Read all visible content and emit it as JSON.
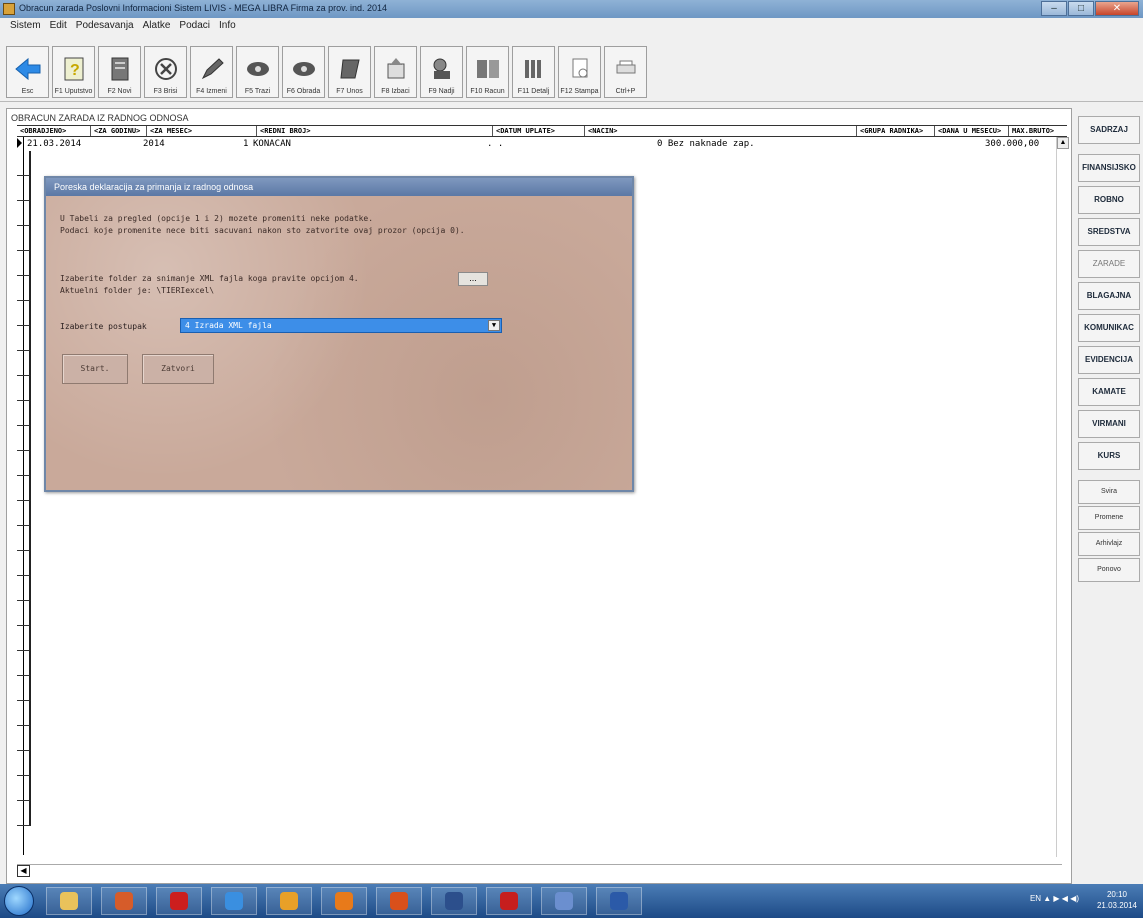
{
  "window": {
    "title": "Obracun zarada  Poslovni Informacioni Sistem LIVIS - MEGA LIBRA  Firma za prov. ind. 2014",
    "controls": [
      "–",
      "□",
      "✕"
    ]
  },
  "menu": [
    "Sistem",
    "Edit",
    "Podesavanja",
    "Alatke",
    "Podaci",
    "Info"
  ],
  "toolbar": [
    {
      "label": "Esc",
      "icon": "back-arrow-icon"
    },
    {
      "label": "F1 Uputstvo",
      "icon": "help-icon"
    },
    {
      "label": "F2 Novi",
      "icon": "new-document-icon"
    },
    {
      "label": "F3 Brisi",
      "icon": "delete-icon"
    },
    {
      "label": "F4 Izmeni",
      "icon": "edit-icon"
    },
    {
      "label": "F5 Trazi",
      "icon": "search-icon"
    },
    {
      "label": "F6 Obrada",
      "icon": "process-icon"
    },
    {
      "label": "F7 Unos",
      "icon": "input-icon"
    },
    {
      "label": "F8 Izbaci",
      "icon": "export-icon"
    },
    {
      "label": "F9 Nadji",
      "icon": "find-icon"
    },
    {
      "label": "F10 Racun",
      "icon": "calculate-icon"
    },
    {
      "label": "F11 Detalj",
      "icon": "detail-icon"
    },
    {
      "label": "F12 Stampa",
      "icon": "print-icon"
    },
    {
      "label": "Ctrl+P",
      "icon": "printer-icon"
    }
  ],
  "grid": {
    "title": "OBRACUN ZARADA IZ RADNOG ODNOSA",
    "headers": [
      "<OBRADJENO>",
      "<ZA GODINU>",
      "<ZA MESEC>",
      "<REDNI BROJ>",
      "<DATUM UPLATE>",
      "<NACIN>",
      "<GRUPA RADNIKA>",
      "<DANA U MESECU>",
      "MAX.BRUTO>"
    ],
    "row": {
      "date": "21.03.2014",
      "year": "2014",
      "month_num": "1",
      "status": "KONACAN",
      "payment_date": ". .",
      "group": "0 Bez naknade zap.",
      "max_bruto": "300.000,00"
    }
  },
  "dialog": {
    "title": "Poreska deklaracija za primanja iz radnog odnosa",
    "lines": [
      "U Tabeli za pregled (opcije 1 i 2) mozete promeniti neke podatke.",
      "Podaci koje promenite nece biti sacuvani nakon sto zatvorite ovaj prozor (opcija 0).",
      "Izaberite folder za snimanje XML fajla koga pravite opcijom 4.",
      "Aktuelni folder je: \\TIERIexcel\\"
    ],
    "browse_label": "...",
    "select_label": "Izaberite postupak",
    "select_value": "4 Izrada XML fajla",
    "start_button": "Start.",
    "close_button": "Zatvori"
  },
  "right_panel": [
    {
      "label": "SADRZAJ",
      "style": "bold"
    },
    {
      "label": "FINANSIJSKO",
      "style": "bold"
    },
    {
      "label": "ROBNO",
      "style": "bold"
    },
    {
      "label": "SREDSTVA",
      "style": "bold"
    },
    {
      "label": "ZARADE",
      "style": "dim"
    },
    {
      "label": "BLAGAJNA",
      "style": "bold"
    },
    {
      "label": "KOMUNIKAC",
      "style": "bold"
    },
    {
      "label": "EVIDENCIJA",
      "style": "bold"
    },
    {
      "label": "KAMATE",
      "style": "bold"
    },
    {
      "label": "VIRMANI",
      "style": "bold"
    },
    {
      "label": "KURS",
      "style": "bold"
    },
    {
      "label": "Svira",
      "style": "light"
    },
    {
      "label": "Promene",
      "style": "light"
    },
    {
      "label": "Arhivlajz",
      "style": "light"
    },
    {
      "label": "Ponovo",
      "style": "light"
    }
  ],
  "taskbar": {
    "tray": "EN  ▲  ▶  ◀  ◀)",
    "time": "20:10",
    "date": "21.03.2014",
    "apps": [
      {
        "icon": "folder-icon",
        "color": "#e9c25b"
      },
      {
        "icon": "app-icon",
        "color": "#d65c2a"
      },
      {
        "icon": "opera-icon",
        "color": "#cc1e1e"
      },
      {
        "icon": "ie-icon",
        "color": "#3a8fe0"
      },
      {
        "icon": "chrome-icon",
        "color": "#e8a028"
      },
      {
        "icon": "firefox-icon",
        "color": "#e87a1a"
      },
      {
        "icon": "mail-icon",
        "color": "#d9501b"
      },
      {
        "icon": "save-icon",
        "color": "#2c4f8c"
      },
      {
        "icon": "fox-icon",
        "color": "#c61e1e"
      },
      {
        "icon": "tool-icon",
        "color": "#6b8fcf"
      },
      {
        "icon": "word-icon",
        "color": "#2b5aa8"
      }
    ]
  }
}
